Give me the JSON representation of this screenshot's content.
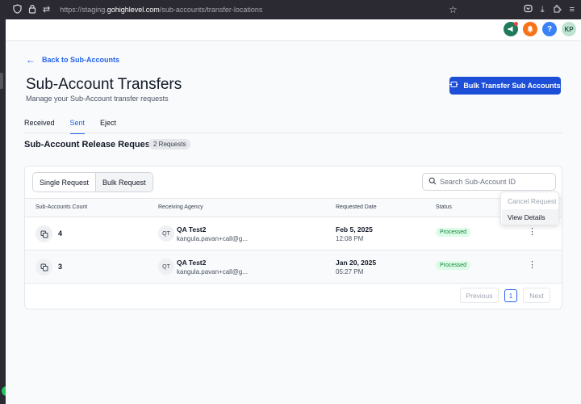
{
  "browser": {
    "url_prefix": "https://staging.",
    "url_host": "gohighlevel.com",
    "url_path": "/sub-accounts/transfer-locations"
  },
  "topbar": {
    "avatar_initials": "KP",
    "help_label": "?"
  },
  "header": {
    "back_label": "Back to Sub-Accounts",
    "title": "Sub-Account Transfers",
    "subtitle": "Manage your Sub-Account transfer requests",
    "bulk_button_label": "Bulk Transfer Sub Accounts"
  },
  "tabs": [
    {
      "label": "Received",
      "active": false
    },
    {
      "label": "Sent",
      "active": true
    },
    {
      "label": "Eject",
      "active": false
    }
  ],
  "section": {
    "title": "Sub-Account Release Requests",
    "badge": "2 Requests"
  },
  "filters": {
    "single_label": "Single Request",
    "bulk_label": "Bulk Request",
    "search_placeholder": "Search Sub-Account ID"
  },
  "table": {
    "columns": [
      "Sub-Accounts Count",
      "Receiving Agency",
      "Requested Date",
      "Status"
    ],
    "rows": [
      {
        "count": "4",
        "agency_initials": "QT",
        "agency_name": "QA Test2",
        "agency_email": "kangula.pavan+call@g...",
        "date": "Feb 5, 2025",
        "time": "12:08 PM",
        "status": "Processed"
      },
      {
        "count": "3",
        "agency_initials": "QT",
        "agency_name": "QA Test2",
        "agency_email": "kangula.pavan+call@g...",
        "date": "Jan 20, 2025",
        "time": "05:27 PM",
        "status": "Processed"
      }
    ]
  },
  "pagination": {
    "previous": "Previous",
    "page": "1",
    "next": "Next"
  },
  "row_menu": {
    "cancel": "Cancel Request",
    "view": "View Details"
  },
  "colors": {
    "primary": "#1d4ed8",
    "link": "#2563eb",
    "status_text": "#15803d",
    "status_bg": "#dcfce7"
  }
}
